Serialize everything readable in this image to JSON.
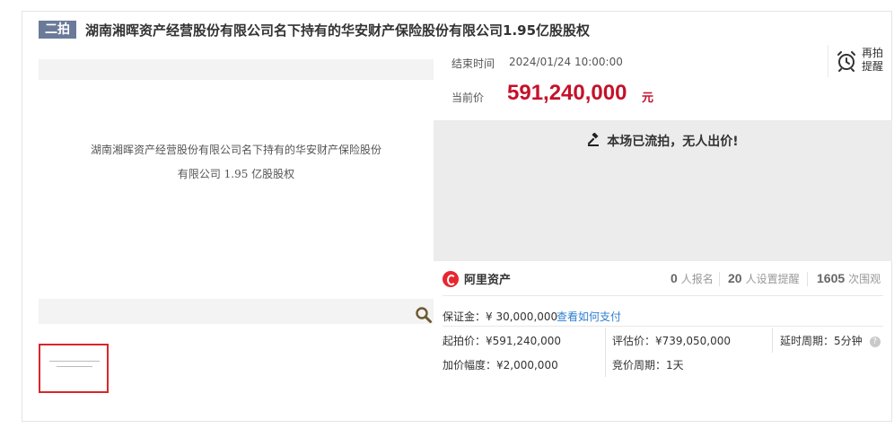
{
  "title": {
    "tag": "二拍",
    "text": "湖南湘晖资产经营股份有限公司名下持有的华安财产保险股份有限公司1.95亿股股权"
  },
  "document": {
    "line1": "湖南湘晖资产经营股份有限公司名下持有的华安财产保险股份",
    "line2": "有限公司 1.95 亿股股权"
  },
  "auction": {
    "end_time_label": "结束时间",
    "end_time": "2024/01/24 10:00:00",
    "current_price_label": "当前价",
    "current_price": "591,240,000",
    "currency": "元",
    "remind_line1": "再拍",
    "remind_line2": "提醒",
    "status": "本场已流拍，无人出价!"
  },
  "platform": {
    "name": "阿里资产"
  },
  "stats": {
    "signups": "0",
    "signups_label": "人报名",
    "reminders": "20",
    "reminders_label": "人设置提醒",
    "views": "1605",
    "views_label": "次围观"
  },
  "details": {
    "deposit": "保证金：¥ 30,000,000",
    "deposit_link": "查看如何支付",
    "start_price": "起拍价：¥591,240,000",
    "assessed_price": "评估价：¥739,050,000",
    "delay_cycle": "延时周期：5分钟",
    "increment": "加价幅度：¥2,000,000",
    "bid_cycle": "竞价周期：1天"
  },
  "colors": {
    "accent": "#c5112a",
    "tag_bg": "#6b7a99",
    "link": "#2f7fd1",
    "thumb_border": "#d9262a"
  }
}
